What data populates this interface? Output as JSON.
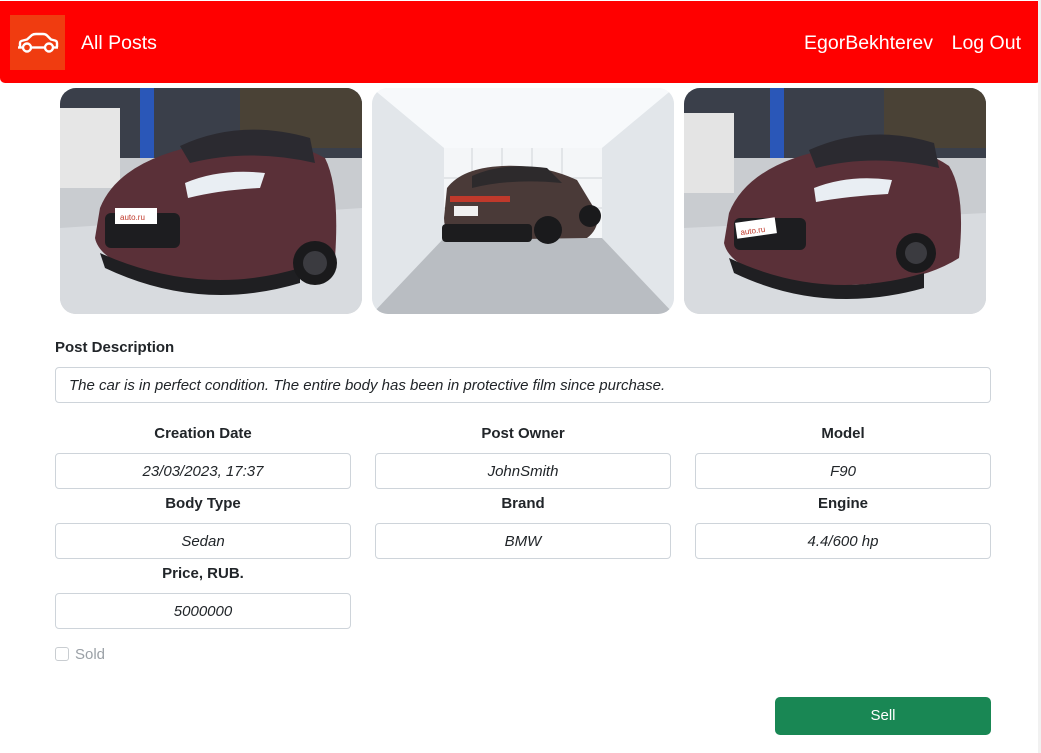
{
  "nav": {
    "logo_icon": "car-icon",
    "all_posts": "All Posts",
    "username": "EgorBekhterev",
    "logout": "Log Out",
    "bg_color": "#ff0000"
  },
  "photos": [
    {
      "caption": "car-front-photo",
      "plate": "auto.ru"
    },
    {
      "caption": "car-rear-photo",
      "plate": ""
    },
    {
      "caption": "car-front-photo-2",
      "plate": "auto.ru"
    }
  ],
  "post": {
    "description_label": "Post Description",
    "description": "The car is in perfect condition. The entire body has been in protective film since purchase.",
    "fields": {
      "creation_date": {
        "label": "Creation Date",
        "value": "23/03/2023, 17:37"
      },
      "post_owner": {
        "label": "Post Owner",
        "value": "JohnSmith"
      },
      "model": {
        "label": "Model",
        "value": "F90"
      },
      "body_type": {
        "label": "Body Type",
        "value": "Sedan"
      },
      "brand": {
        "label": "Brand",
        "value": "BMW"
      },
      "engine": {
        "label": "Engine",
        "value": "4.4/600 hp"
      },
      "price": {
        "label": "Price, RUB.",
        "value": "5000000"
      }
    },
    "sold_label": "Sold",
    "sold_checked": false
  },
  "actions": {
    "sell": "Sell",
    "sell_color": "#198754"
  }
}
